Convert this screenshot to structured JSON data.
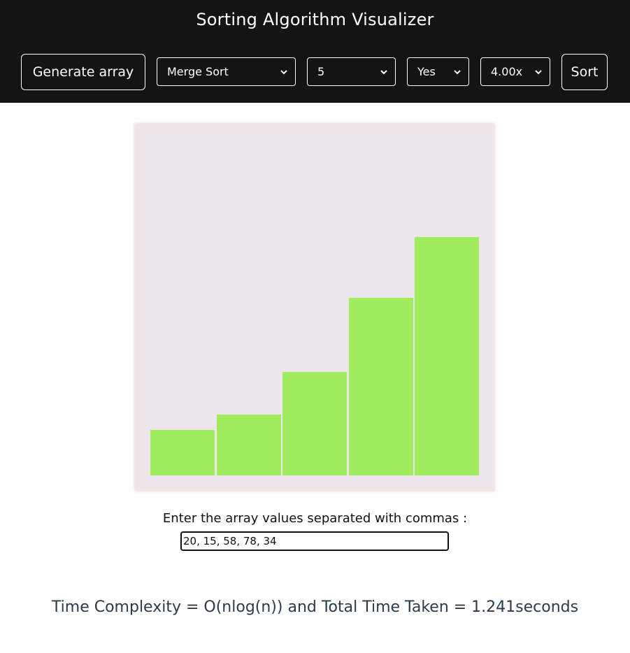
{
  "header": {
    "title": "Sorting Algorithm Visualizer",
    "generate_label": "Generate array",
    "algorithm_selected": "Merge Sort",
    "size_selected": "5",
    "option_selected": "Yes",
    "speed_selected": "4.00x",
    "sort_label": "Sort"
  },
  "colors": {
    "header_bg": "#141414",
    "bar": "#a0ec5e",
    "canvas_bg": "#ede6ea",
    "complexity_text": "#2c3a4b"
  },
  "bars": {
    "max_value": 100,
    "values": [
      19,
      25.5,
      43.5,
      74.5,
      100
    ]
  },
  "input": {
    "label": "Enter the array values separated with commas :",
    "value": "20, 15, 58, 78, 34"
  },
  "result": {
    "text": "Time Complexity = O(nlog(n)) and Total Time Taken = 1.241seconds"
  }
}
